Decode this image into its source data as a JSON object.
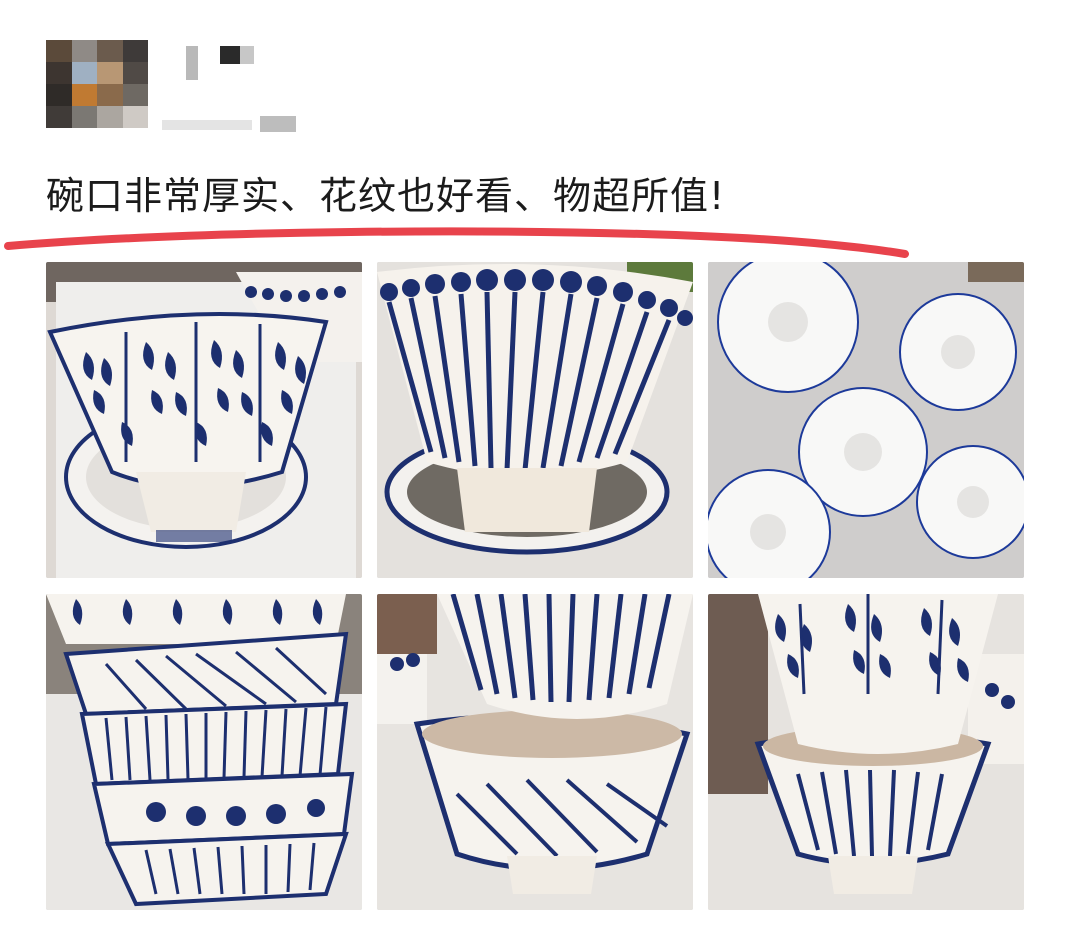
{
  "post": {
    "review_text": "碗口非常厚实、花纹也好看、物超所值!",
    "annotation_color": "#e8434c"
  },
  "photos": [
    {
      "name": "leaf-pattern-bowl-on-plate",
      "pattern": "leaf"
    },
    {
      "name": "line-dot-pattern-bowl",
      "pattern": "line-dot"
    },
    {
      "name": "white-bowl-interiors",
      "pattern": "plain"
    },
    {
      "name": "stacked-bowls",
      "pattern": "stack"
    },
    {
      "name": "line-bowl-on-diagonal-bowl",
      "pattern": "line-diagonal"
    },
    {
      "name": "leaf-bowl-on-line-bowl",
      "pattern": "leaf-line"
    }
  ]
}
